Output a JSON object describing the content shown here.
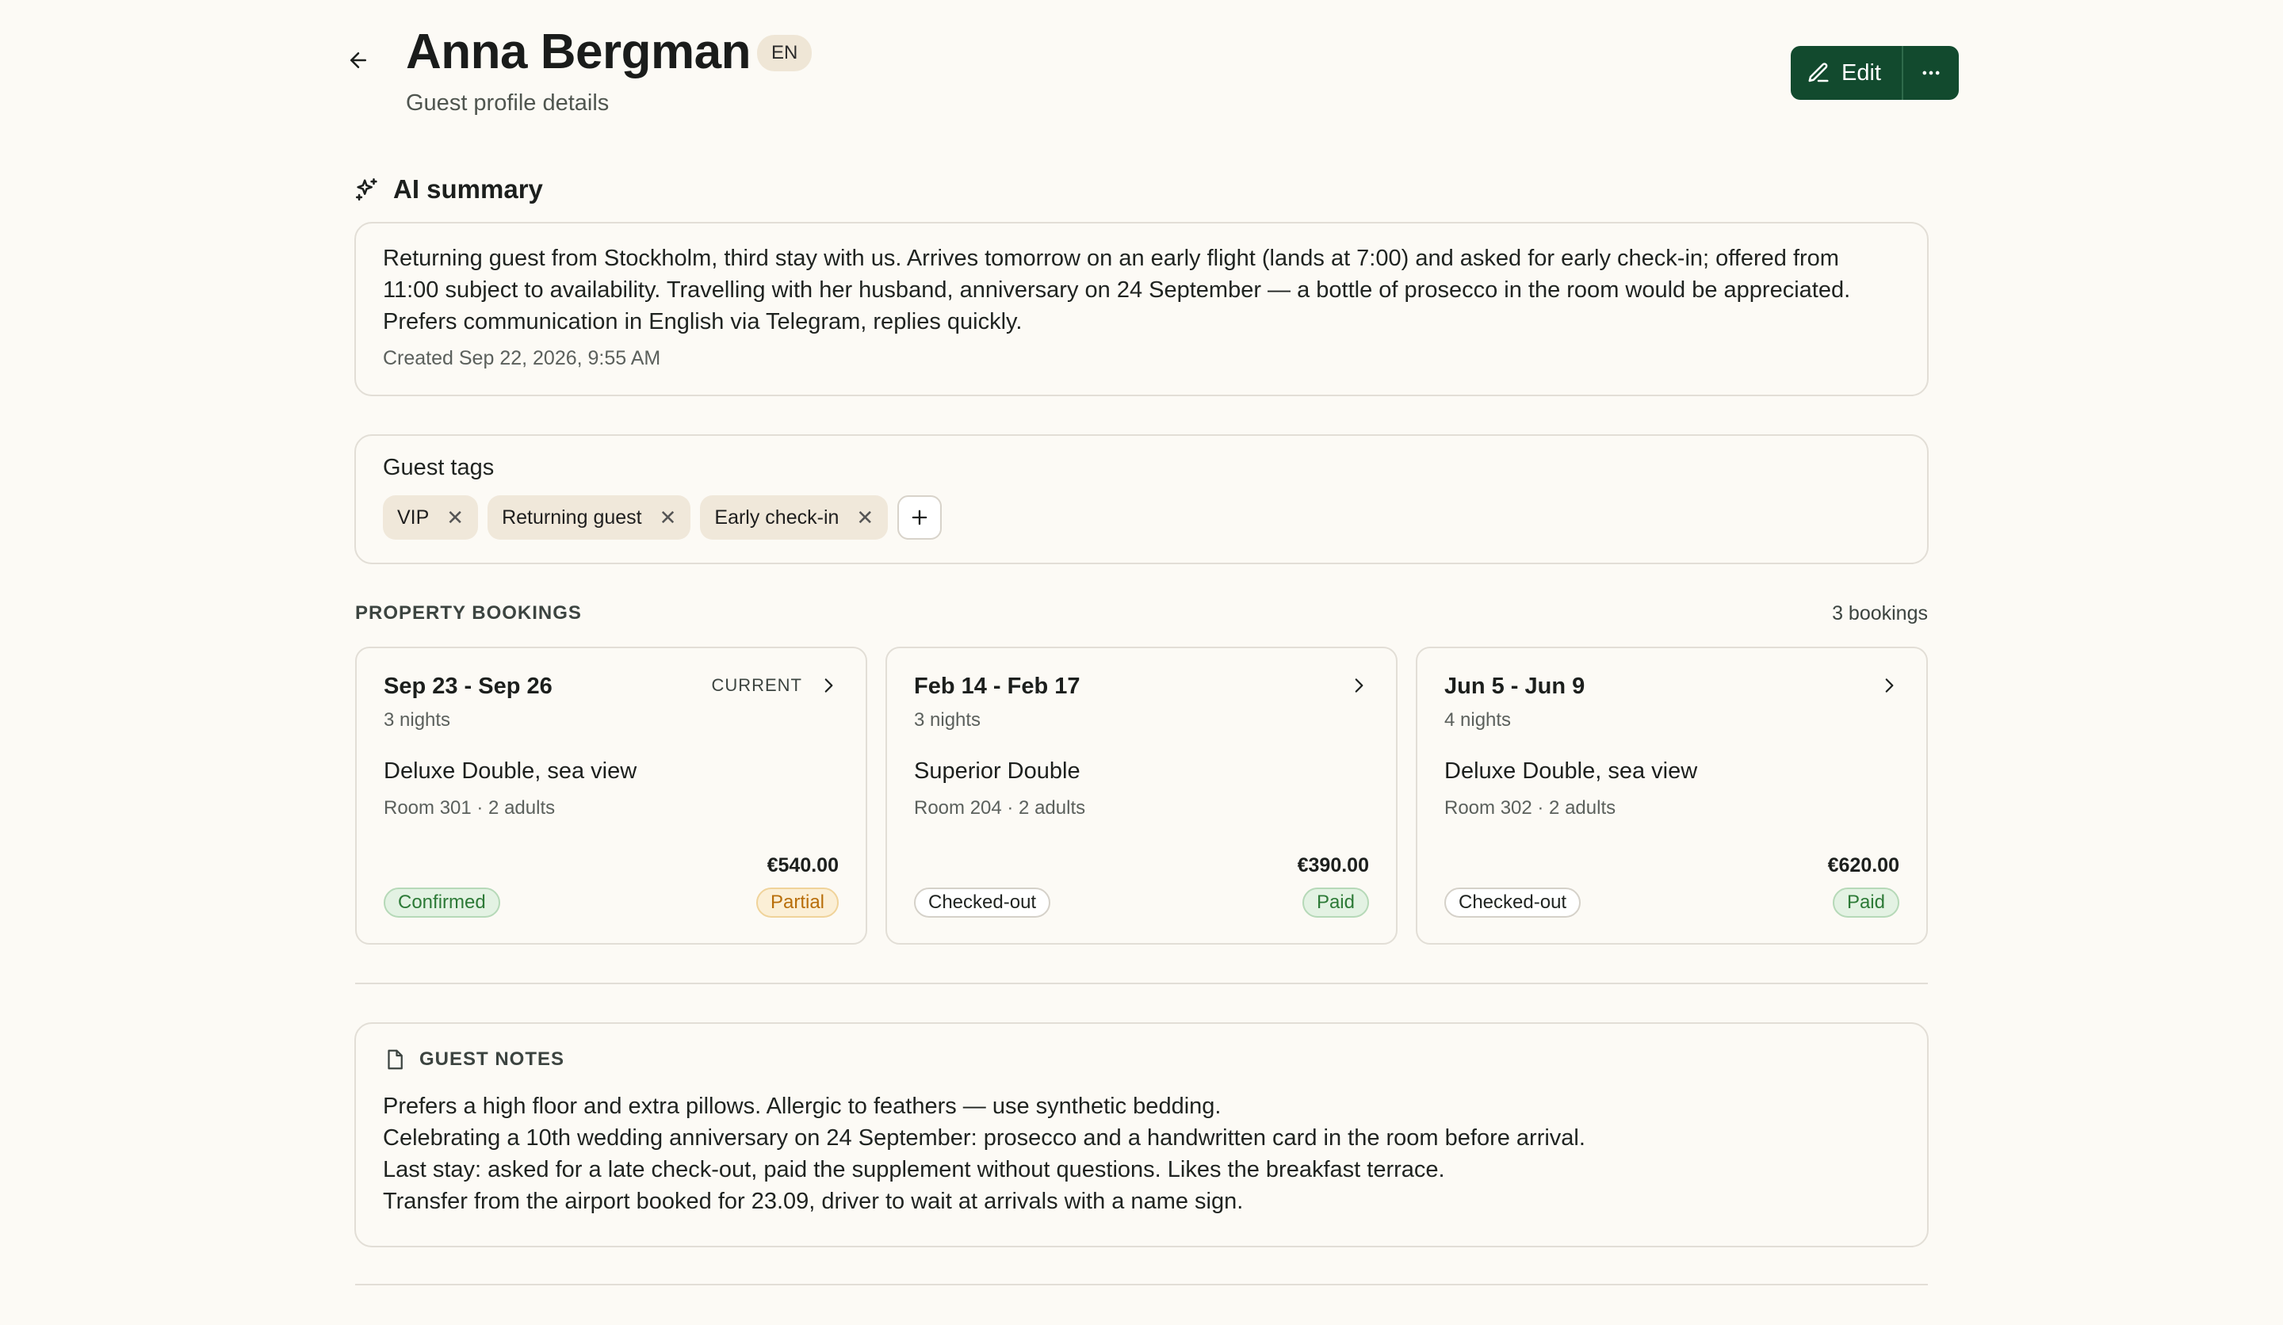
{
  "header": {
    "title": "Anna Bergman",
    "language_badge": "EN",
    "subtitle": "Guest profile details",
    "edit_label": "Edit"
  },
  "ai_summary": {
    "heading": "AI summary",
    "text": "Returning guest from Stockholm, third stay with us. Arrives tomorrow on an early flight (lands at 7:00) and asked for early check-in; offered from 11:00 subject to availability. Travelling with her husband, anniversary on 24 September — a bottle of prosecco in the room would be appreciated. Prefers communication in English via Telegram, replies quickly.",
    "created": "Created Sep 22, 2026, 9:55 AM"
  },
  "tags": {
    "title": "Guest tags",
    "items": [
      "VIP",
      "Returning guest",
      "Early check-in"
    ]
  },
  "bookings": {
    "section_label": "PROPERTY BOOKINGS",
    "count": "3 bookings",
    "items": [
      {
        "dates": "Sep 23 - Sep 26",
        "nights": "3 nights",
        "current": "CURRENT",
        "room_type": "Deluxe Double, sea view",
        "detail": "Room 301 · 2 adults",
        "price": "€540.00",
        "status": "Confirmed",
        "payment": "Partial"
      },
      {
        "dates": "Feb 14 - Feb 17",
        "nights": "3 nights",
        "current": "",
        "room_type": "Superior Double",
        "detail": "Room 204 · 2 adults",
        "price": "€390.00",
        "status": "Checked-out",
        "payment": "Paid"
      },
      {
        "dates": "Jun 5 - Jun 9",
        "nights": "4 nights",
        "current": "",
        "room_type": "Deluxe Double, sea view",
        "detail": "Room 302 · 2 adults",
        "price": "€620.00",
        "status": "Checked-out",
        "payment": "Paid"
      }
    ]
  },
  "notes": {
    "heading": "GUEST NOTES",
    "lines": [
      "Prefers a high floor and extra pillows. Allergic to feathers — use synthetic bedding.",
      "Celebrating a 10th wedding anniversary on 24 September: prosecco and a handwritten card in the room before arrival.",
      "Last stay: asked for a late check-out, paid the supplement without questions. Likes the breakfast terrace.",
      "Transfer from the airport booked for 23.09, driver to wait at arrivals with a name sign."
    ]
  },
  "icons": {
    "back": "arrow-left-icon",
    "edit": "pencil-icon",
    "more": "more-horizontal-icon",
    "ai": "sparkles-icon",
    "tag_remove": "close-icon",
    "tag_add": "plus-icon",
    "booking_open": "chevron-right-icon",
    "notes": "file-icon"
  },
  "colors": {
    "brand": "#124a2e",
    "background": "#fcfaf5",
    "confirmed": "#2d7a37",
    "partial": "#b86e0a"
  }
}
